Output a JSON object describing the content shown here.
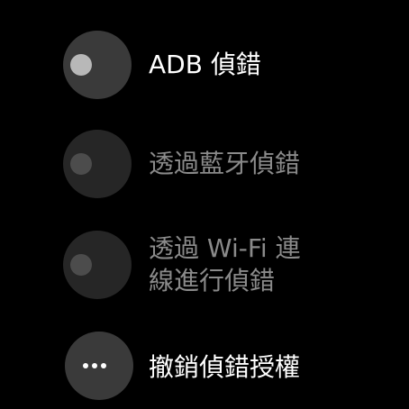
{
  "colors": {
    "background": "#000000",
    "text_enabled": "#ffffff",
    "text_disabled": "#8a8a8a",
    "circle_enabled": "#3a3a3a",
    "circle_disabled": "#262626",
    "knob_enabled": "#b8b8b8",
    "knob_disabled": "#4c4c4c"
  },
  "items": [
    {
      "label": "ADB 偵錯",
      "icon": "toggle-off-icon",
      "enabled": true
    },
    {
      "label": "透過藍牙偵錯",
      "icon": "toggle-off-icon",
      "enabled": false
    },
    {
      "label": "透過 Wi-Fi 連線進行偵錯",
      "icon": "toggle-off-icon",
      "enabled": false
    },
    {
      "label": "撤銷偵錯授權",
      "icon": "more-horiz-icon",
      "enabled": true
    }
  ]
}
